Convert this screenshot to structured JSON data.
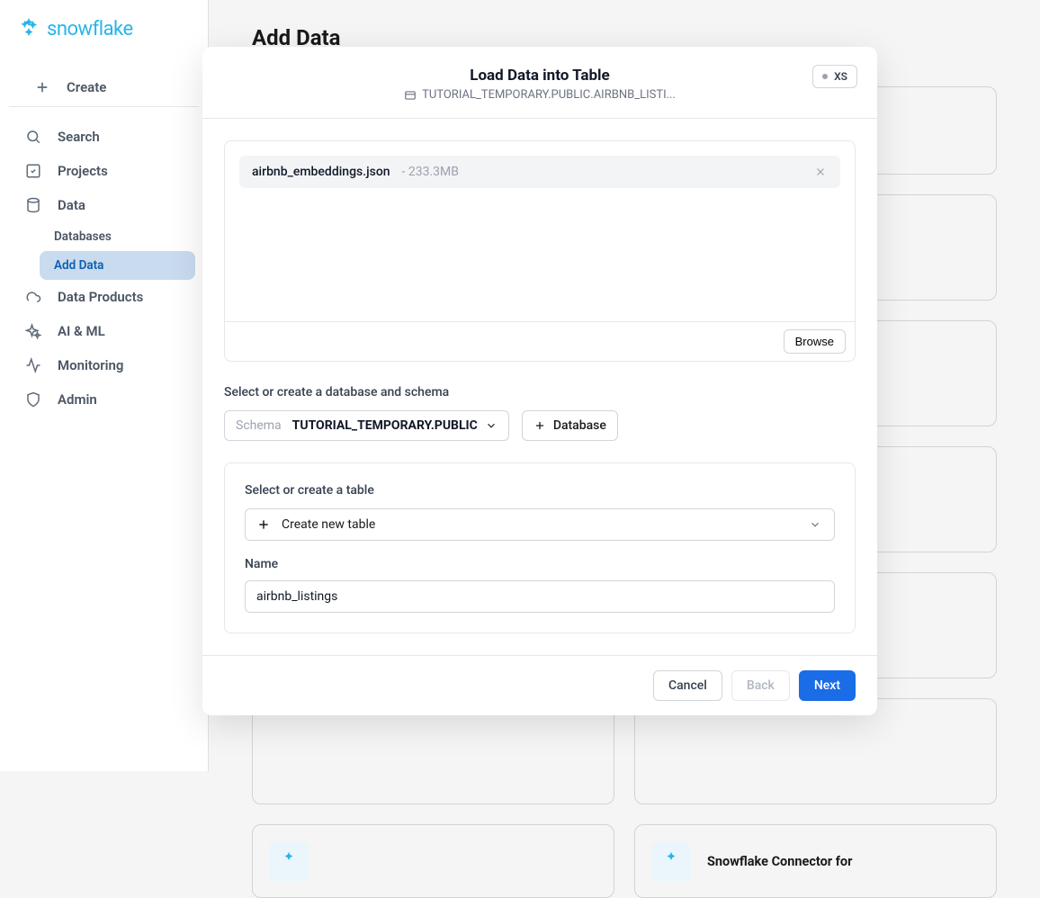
{
  "brand": {
    "name": "snowflake"
  },
  "sidebar": {
    "create": "Create",
    "items": [
      {
        "label": "Search",
        "icon": "search-icon"
      },
      {
        "label": "Projects",
        "icon": "projects-icon"
      },
      {
        "label": "Data",
        "icon": "data-icon"
      },
      {
        "label": "Data Products",
        "icon": "cloud-icon"
      },
      {
        "label": "AI & ML",
        "icon": "sparkles-icon"
      },
      {
        "label": "Monitoring",
        "icon": "activity-icon"
      },
      {
        "label": "Admin",
        "icon": "shield-icon"
      }
    ],
    "data_sub": [
      {
        "label": "Databases",
        "active": false
      },
      {
        "label": "Add Data",
        "active": true
      }
    ]
  },
  "page": {
    "title": "Add Data"
  },
  "modal": {
    "title": "Load Data into Table",
    "subtitle": "TUTORIAL_TEMPORARY.PUBLIC.AIRBNB_LISTI...",
    "warehouse_badge": "XS",
    "file": {
      "name": "airbnb_embeddings.json",
      "size": "- 233.3MB"
    },
    "browse_label": "Browse",
    "select_schema_label": "Select or create a database and schema",
    "schema_label": "Schema",
    "schema_value": "TUTORIAL_TEMPORARY.PUBLIC",
    "database_button": "Database",
    "select_table_label": "Select or create a table",
    "table_select_value": "Create new table",
    "name_label": "Name",
    "name_value": "airbnb_listings",
    "footer": {
      "cancel": "Cancel",
      "back": "Back",
      "next": "Next"
    }
  },
  "connector": {
    "title": "Snowflake Connector for"
  }
}
